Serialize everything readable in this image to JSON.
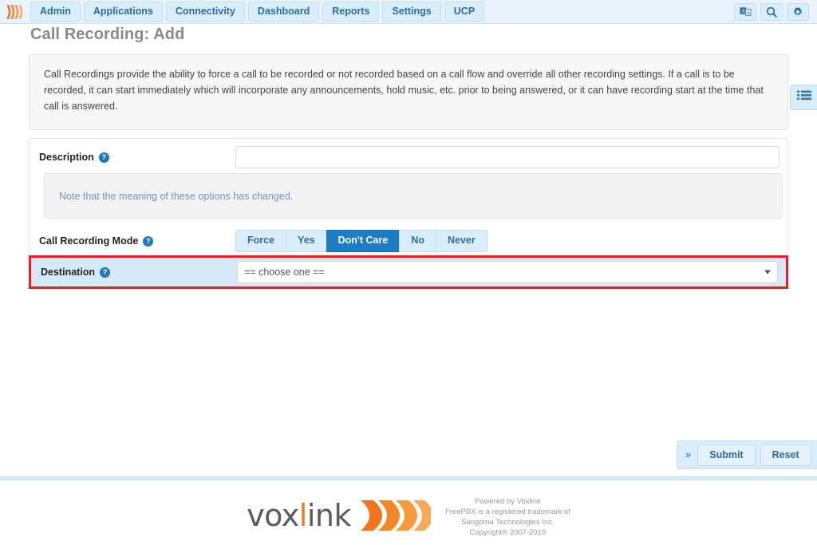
{
  "nav": {
    "brand_icon": "voxlink-wave-logo",
    "tabs": [
      {
        "label": "Admin"
      },
      {
        "label": "Applications"
      },
      {
        "label": "Connectivity"
      },
      {
        "label": "Dashboard"
      },
      {
        "label": "Reports"
      },
      {
        "label": "Settings"
      },
      {
        "label": "UCP"
      }
    ],
    "icons": [
      {
        "name": "translate-icon"
      },
      {
        "name": "search-icon"
      },
      {
        "name": "gear-icon"
      }
    ]
  },
  "page": {
    "title": "Call Recording: Add",
    "info_text": "Call Recordings provide the ability to force a call to be recorded or not recorded based on a call flow and override all other recording settings. If a call is to be recorded, it can start immediately which will incorporate any announcements, hold music, etc. prior to being answered, or it can have recording start at the time that call is answered."
  },
  "side_toggle": {
    "icon": "list-panel-icon"
  },
  "form": {
    "description": {
      "label": "Description",
      "help": "?",
      "value": "",
      "placeholder": ""
    },
    "note": {
      "text": "Note that the meaning of these options has changed."
    },
    "call_recording_mode": {
      "label": "Call Recording Mode",
      "help": "?",
      "options": [
        "Force",
        "Yes",
        "Don't Care",
        "No",
        "Never"
      ],
      "selected": "Don't Care"
    },
    "destination": {
      "label": "Destination",
      "help": "?",
      "selected": "== choose one ==",
      "highlighted": true
    }
  },
  "actions": {
    "expand_label": "»",
    "submit_label": "Submit",
    "reset_label": "Reset"
  },
  "footer": {
    "logo_text_a": "vox",
    "logo_text_i": "l",
    "logo_text_b": "ink",
    "logo_word": "voxlink",
    "legal_lines": [
      "Powered by Voxlink",
      "FreePBX is a registered trademark of",
      "Sangoma Technologies Inc.",
      "Copyright® 2007-2019"
    ]
  },
  "colors": {
    "nav_bg": "#e8f3fb",
    "tab_bg": "#daedfa",
    "tab_text": "#2b6ca3",
    "accent_blue": "#1d7dc4",
    "highlight_red": "#ee1c1c",
    "highlight_row_bg": "#d6e9f8",
    "brand_orange": "#f07c20",
    "note_text": "#6a97c4"
  }
}
